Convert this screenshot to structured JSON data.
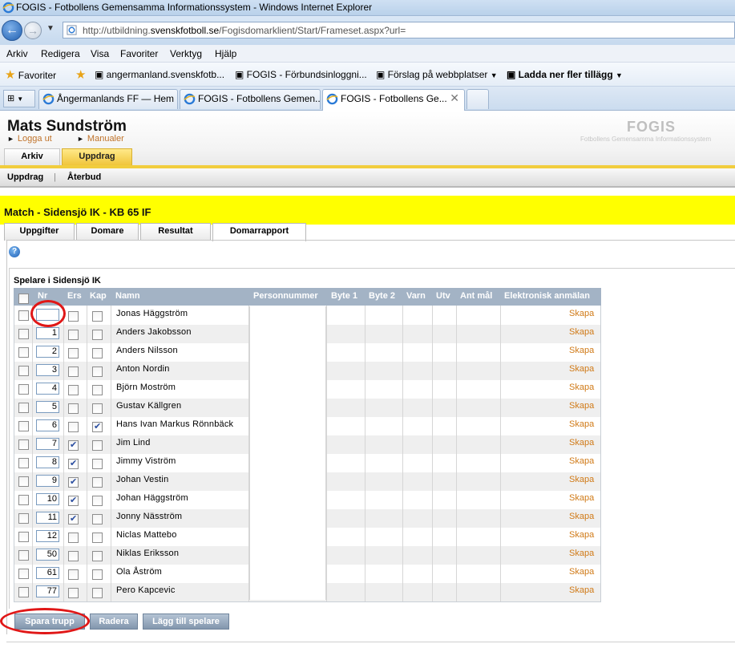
{
  "window": {
    "title": "FOGIS - Fotbollens Gemensamma Informationssystem - Windows Internet Explorer"
  },
  "address": {
    "prefix": "http://utbildning.",
    "domain": "svenskfotboll.se",
    "path": "/Fogisdomarklient/Start/Frameset.aspx?url="
  },
  "menu": [
    "Arkiv",
    "Redigera",
    "Visa",
    "Favoriter",
    "Verktyg",
    "Hjälp"
  ],
  "favorites": {
    "label": "Favoriter",
    "items": [
      "angermanland.svenskfotb...",
      "FOGIS - Förbundsinloggni...",
      "Förslag på webbplatser",
      "Ladda ner fler tillägg"
    ]
  },
  "browser_tabs": [
    {
      "label": "Ångermanlands FF — Hem",
      "active": false
    },
    {
      "label": "FOGIS - Fotbollens Gemen...",
      "active": false
    },
    {
      "label": "FOGIS - Fotbollens Ge...",
      "active": true
    }
  ],
  "header": {
    "user": "Mats Sundström",
    "logout": "Logga ut",
    "manuals": "Manualer",
    "logo": "FOGIS",
    "logo_sub": "Fotbollens Gemensamma Informationssystem",
    "tabs": [
      "Arkiv",
      "Uppdrag"
    ]
  },
  "subnav": [
    "Uppdrag",
    "Återbud"
  ],
  "match": {
    "title": "Match - Sidensjö IK - KB 65 IF"
  },
  "page_tabs": [
    "Uppgifter",
    "Domare",
    "Resultat",
    "Domarrapport"
  ],
  "players_heading": "Spelare i Sidensjö IK",
  "columns": {
    "nr": "Nr",
    "ers": "Ers",
    "kap": "Kap",
    "namn": "Namn",
    "pnr": "Personnummer",
    "byte1": "Byte 1",
    "byte2": "Byte 2",
    "varn": "Varn",
    "utv": "Utv",
    "mal": "Ant mål",
    "elek": "Elektronisk anmälan"
  },
  "players": [
    {
      "nr": "",
      "name": "Jonas Häggström",
      "ers": false,
      "kap": false,
      "action": "Skapa"
    },
    {
      "nr": "1",
      "name": "Anders Jakobsson",
      "ers": false,
      "kap": false,
      "action": "Skapa"
    },
    {
      "nr": "2",
      "name": "Anders Nilsson",
      "ers": false,
      "kap": false,
      "action": "Skapa"
    },
    {
      "nr": "3",
      "name": "Anton Nordin",
      "ers": false,
      "kap": false,
      "action": "Skapa"
    },
    {
      "nr": "4",
      "name": "Björn Moström",
      "ers": false,
      "kap": false,
      "action": "Skapa"
    },
    {
      "nr": "5",
      "name": "Gustav Källgren",
      "ers": false,
      "kap": false,
      "action": "Skapa"
    },
    {
      "nr": "6",
      "name": "Hans Ivan Markus Rönnbäck",
      "ers": false,
      "kap": true,
      "action": "Skapa"
    },
    {
      "nr": "7",
      "name": "Jim Lind",
      "ers": true,
      "kap": false,
      "action": "Skapa"
    },
    {
      "nr": "8",
      "name": "Jimmy Viström",
      "ers": true,
      "kap": false,
      "action": "Skapa"
    },
    {
      "nr": "9",
      "name": "Johan Vestin",
      "ers": true,
      "kap": false,
      "action": "Skapa"
    },
    {
      "nr": "10",
      "name": "Johan Häggström",
      "ers": true,
      "kap": false,
      "action": "Skapa"
    },
    {
      "nr": "11",
      "name": "Jonny Näsström",
      "ers": true,
      "kap": false,
      "action": "Skapa"
    },
    {
      "nr": "12",
      "name": "Niclas Mattebo",
      "ers": false,
      "kap": false,
      "action": "Skapa"
    },
    {
      "nr": "50",
      "name": "Niklas Eriksson",
      "ers": false,
      "kap": false,
      "action": "Skapa"
    },
    {
      "nr": "61",
      "name": "Ola Åström",
      "ers": false,
      "kap": false,
      "action": "Skapa"
    },
    {
      "nr": "77",
      "name": "Pero Kapcevic",
      "ers": false,
      "kap": false,
      "action": "Skapa"
    }
  ],
  "buttons": {
    "save": "Spara trupp",
    "delete": "Radera",
    "add": "Lägg till spelare"
  },
  "colors": {
    "header_yellow": "#ffff00",
    "tab_yellow": "#f0c53b",
    "table_header": "#a3b3c5",
    "link_orange": "#d07a17",
    "annotation_red": "#e01717"
  }
}
